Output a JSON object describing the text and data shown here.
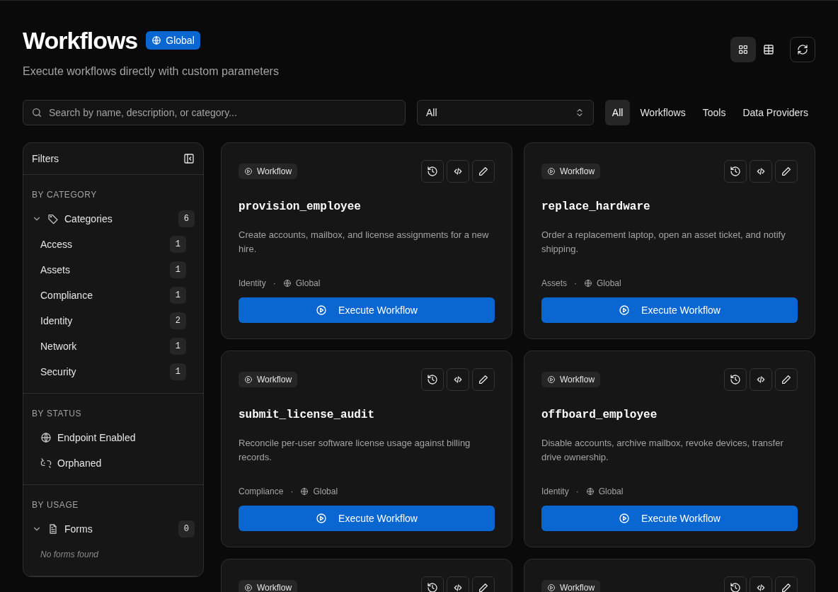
{
  "header": {
    "title": "Workflows",
    "scope_badge": "Global",
    "subtitle": "Execute workflows directly with custom parameters"
  },
  "view_toggle": [
    {
      "kind": "grid",
      "selected": true
    },
    {
      "kind": "table",
      "selected": false
    }
  ],
  "search": {
    "placeholder": "Search by name, description, or category..."
  },
  "type_select": {
    "value": "All"
  },
  "type_tabs": [
    {
      "label": "All",
      "selected": true
    },
    {
      "label": "Workflows",
      "selected": false
    },
    {
      "label": "Tools",
      "selected": false
    },
    {
      "label": "Data Providers",
      "selected": false
    }
  ],
  "filters": {
    "title": "Filters",
    "sections": [
      {
        "heading": "BY CATEGORY",
        "groups": [
          {
            "kind": "tag",
            "label": "Categories",
            "count": "6",
            "expanded": true,
            "items": [
              {
                "label": "Access",
                "count": "1"
              },
              {
                "label": "Assets",
                "count": "1"
              },
              {
                "label": "Compliance",
                "count": "1"
              },
              {
                "label": "Identity",
                "count": "2"
              },
              {
                "label": "Network",
                "count": "1"
              },
              {
                "label": "Security",
                "count": "1"
              }
            ]
          }
        ]
      },
      {
        "heading": "BY STATUS",
        "statuses": [
          {
            "kind": "globe",
            "label": "Endpoint Enabled"
          },
          {
            "kind": "unlink",
            "label": "Orphaned"
          }
        ]
      },
      {
        "heading": "BY USAGE",
        "groups": [
          {
            "kind": "file",
            "label": "Forms",
            "count": "0",
            "expanded": true,
            "empty_text": "No forms found"
          }
        ]
      }
    ]
  },
  "cards": [
    {
      "type": "Workflow",
      "name": "provision_employee",
      "description": "Create accounts, mailbox, and license assignments for a new hire.",
      "category": "Identity",
      "separator": "·",
      "scope": "Global",
      "action": "Execute Workflow"
    },
    {
      "type": "Workflow",
      "name": "replace_hardware",
      "description": "Order a replacement laptop, open an asset ticket, and notify shipping.",
      "category": "Assets",
      "separator": "·",
      "scope": "Global",
      "action": "Execute Workflow"
    },
    {
      "type": "Workflow",
      "name": "submit_license_audit",
      "description": "Reconcile per-user software license usage against billing records.",
      "category": "Compliance",
      "separator": "·",
      "scope": "Global",
      "action": "Execute Workflow"
    },
    {
      "type": "Workflow",
      "name": "offboard_employee",
      "description": "Disable accounts, archive mailbox, revoke devices, transfer drive ownership.",
      "category": "Identity",
      "separator": "·",
      "scope": "Global",
      "action": "Execute Workflow"
    },
    {
      "type": "Workflow"
    },
    {
      "type": "Workflow"
    }
  ]
}
